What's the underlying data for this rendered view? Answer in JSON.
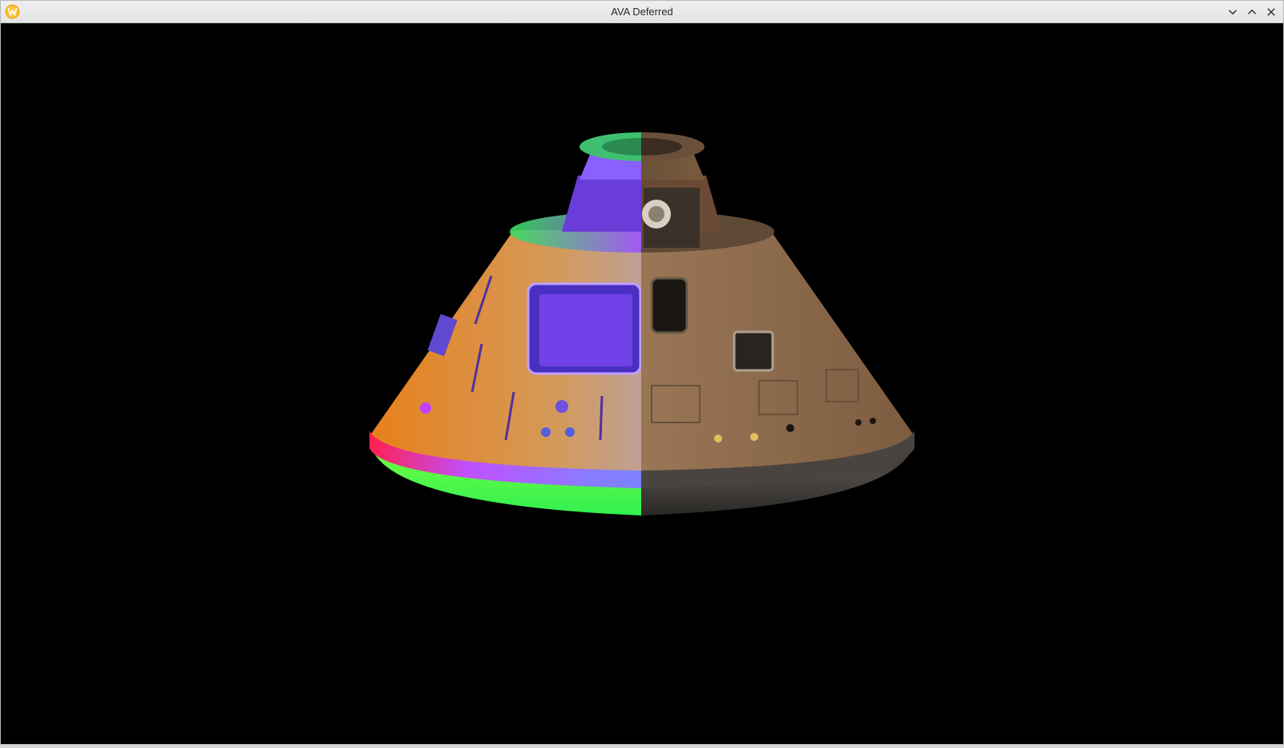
{
  "window": {
    "title": "AVA Deferred",
    "app_icon": "avalonia-logo-icon",
    "controls": {
      "minimize_icon": "chevron-down-icon",
      "maximize_icon": "chevron-up-icon",
      "close_icon": "close-icon"
    }
  },
  "viewport": {
    "background": "#000000",
    "scene": {
      "object": "capsule-model",
      "left_half_render": "normal-map",
      "right_half_render": "albedo-texture"
    }
  },
  "colors": {
    "titlebar_bg": "#e8e8e8",
    "titlebar_text": "#2b2b2b",
    "app_icon_color": "#f3b01c"
  }
}
